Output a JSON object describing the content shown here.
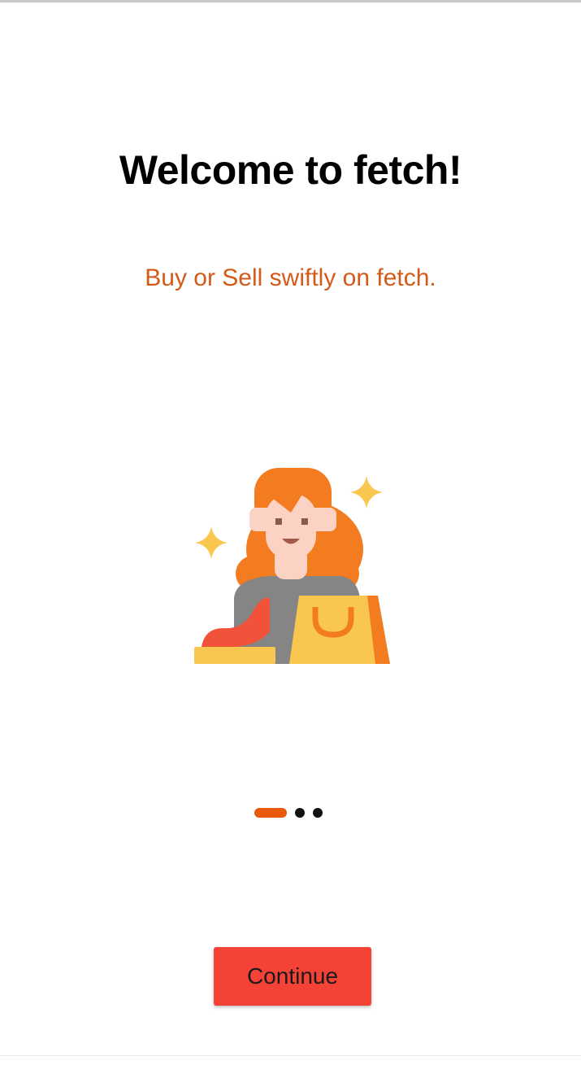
{
  "onboarding": {
    "title": "Welcome to fetch!",
    "subtitle": "Buy or Sell swiftly on fetch.",
    "illustration_icon": "woman-shopping-icon",
    "page_indicator": {
      "current": 1,
      "total": 3
    },
    "continue_label": "Continue"
  },
  "colors": {
    "accent": "#e8590c",
    "subtitle": "#d45a18",
    "button": "#f44336"
  }
}
